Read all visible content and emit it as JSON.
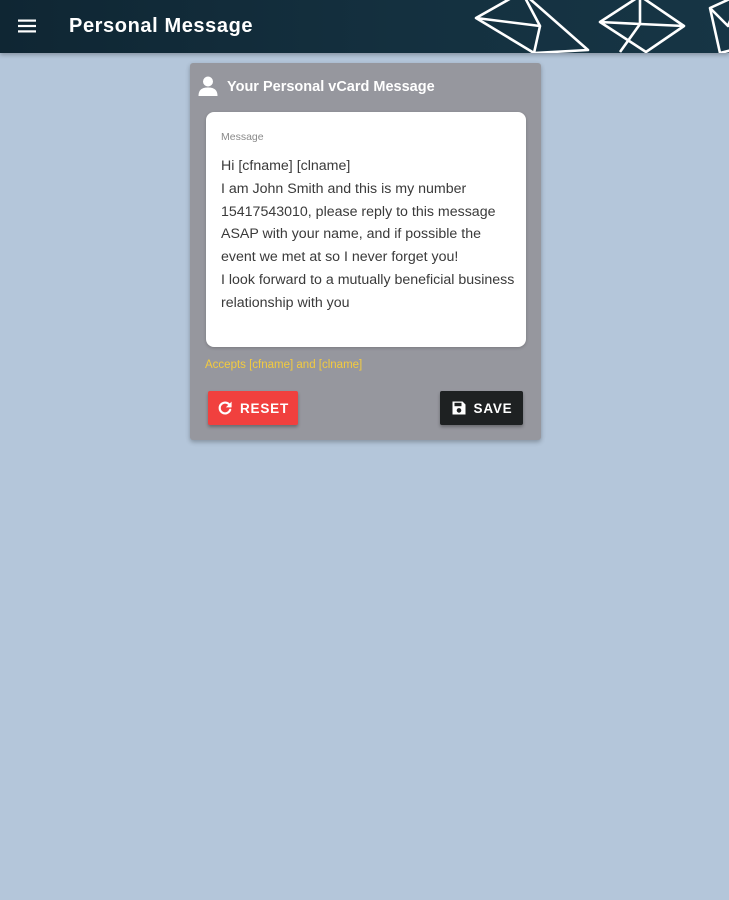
{
  "app_bar": {
    "title": "Personal Message",
    "menu_icon": "menu-icon",
    "background": "#102a38"
  },
  "card": {
    "icon": "person-icon",
    "title": "Your Personal vCard Message",
    "message": {
      "label": "Message",
      "value": "Hi [cfname] [clname]\nI am John Smith and this is my number 15417543010, please reply to this message ASAP with your name, and if possible the event we met at so I never forget you!\nI look forward to a mutually beneficial business relationship with you"
    },
    "hint": "Accepts [cfname] and [clname]",
    "reset_button": {
      "label": "RESET",
      "icon": "refresh-icon",
      "color": "#f1403e"
    },
    "save_button": {
      "label": "SAVE",
      "icon": "floppy-disk-icon",
      "color": "#1e2122"
    }
  },
  "colors": {
    "page_background": "#b4c6da",
    "card_background": "#96979e",
    "hint_color": "#f3cb3e"
  }
}
